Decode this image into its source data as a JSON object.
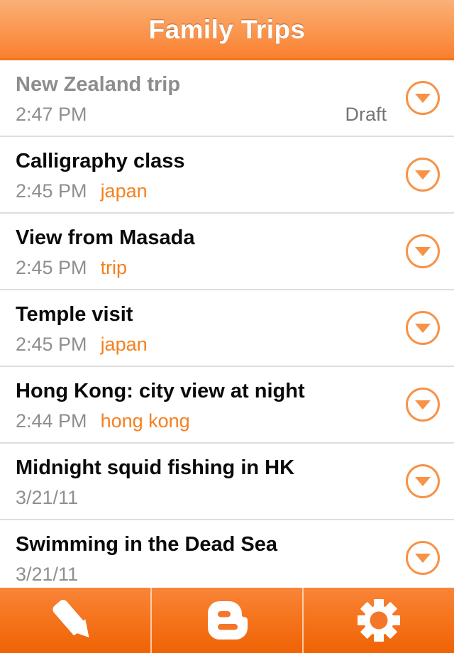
{
  "header": {
    "title": "Family Trips"
  },
  "colors": {
    "accent_orange": "#f5801f",
    "header_gradient_top": "#fbb077",
    "header_gradient_bottom": "#f67c28",
    "toolbar_gradient_top": "#f9853a",
    "toolbar_gradient_bottom": "#ef6305",
    "title_text": "#0a0a0a",
    "draft_title_text": "#8d8d8d",
    "meta_text": "#8f8f8f",
    "status_text": "#757575",
    "separator": "#dedede",
    "disclosure_ring": "#f79246"
  },
  "list": {
    "rows": [
      {
        "title": "New Zealand trip",
        "time": "2:47 PM",
        "label": "",
        "status": "Draft",
        "is_draft": true,
        "disclosure_icon": "chevron-down-circle-icon"
      },
      {
        "title": "Calligraphy class",
        "time": "2:45 PM",
        "label": "japan",
        "status": "",
        "is_draft": false,
        "disclosure_icon": "chevron-down-circle-icon"
      },
      {
        "title": "View from Masada",
        "time": "2:45 PM",
        "label": "trip",
        "status": "",
        "is_draft": false,
        "disclosure_icon": "chevron-down-circle-icon"
      },
      {
        "title": "Temple visit",
        "time": "2:45 PM",
        "label": "japan",
        "status": "",
        "is_draft": false,
        "disclosure_icon": "chevron-down-circle-icon"
      },
      {
        "title": "Hong Kong: city view at night",
        "time": "2:44 PM",
        "label": "hong kong",
        "status": "",
        "is_draft": false,
        "disclosure_icon": "chevron-down-circle-icon"
      },
      {
        "title": "Midnight squid fishing in HK",
        "time": "3/21/11",
        "label": "",
        "status": "",
        "is_draft": false,
        "disclosure_icon": "chevron-down-circle-icon"
      },
      {
        "title": "Swimming in the Dead Sea",
        "time": "3/21/11",
        "label": "",
        "status": "",
        "is_draft": false,
        "disclosure_icon": "chevron-down-circle-icon"
      }
    ]
  },
  "toolbar": {
    "buttons": [
      {
        "name": "compose",
        "icon": "pencil-icon"
      },
      {
        "name": "blog",
        "icon": "blogger-logo-icon"
      },
      {
        "name": "settings",
        "icon": "gear-icon"
      }
    ]
  }
}
